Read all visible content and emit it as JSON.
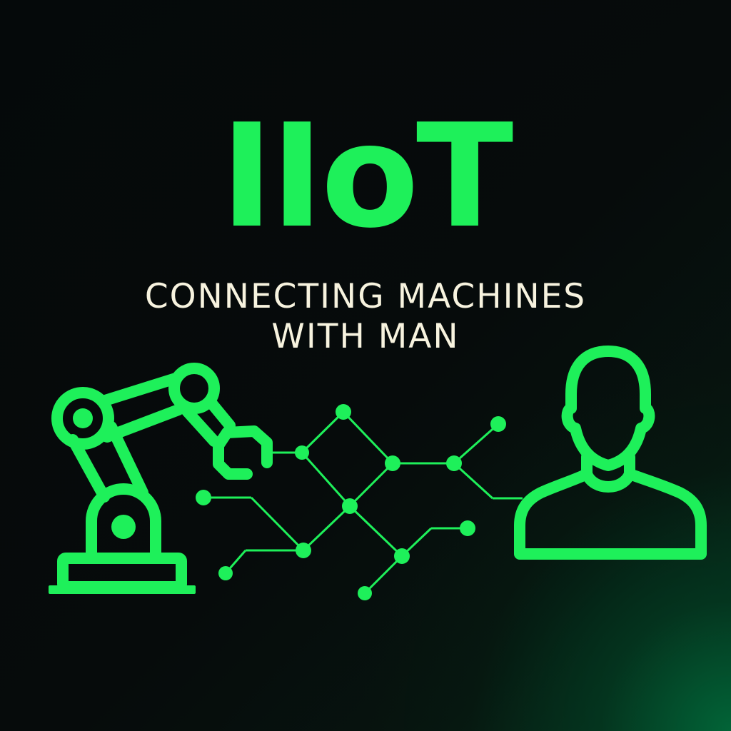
{
  "colors": {
    "accent": "#1ef05a",
    "text_light": "#f7f3df",
    "background": "#060a0b",
    "corner_glow": "#00603a"
  },
  "title": "IIoT",
  "subtitle": {
    "line1": "CONNECTING MACHINES",
    "line2": "WITH MAN"
  },
  "icons": [
    "robot-arm-icon",
    "network-graph-icon",
    "person-icon"
  ]
}
